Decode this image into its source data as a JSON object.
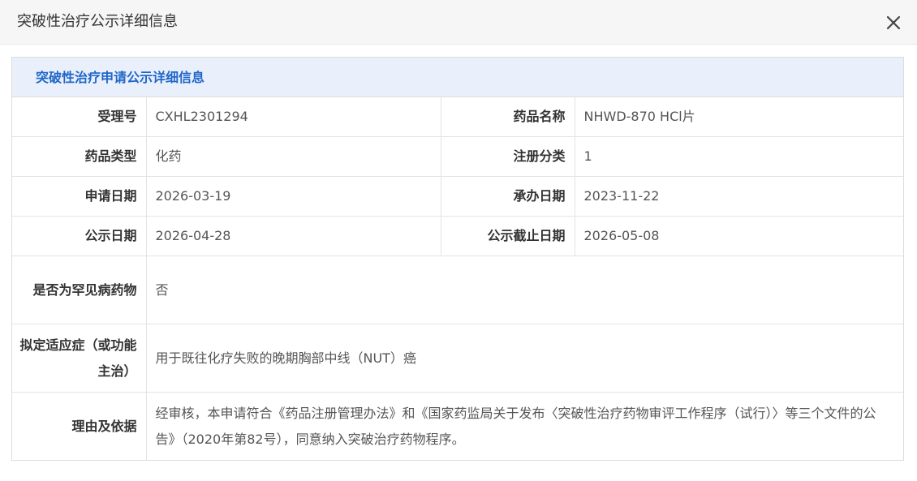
{
  "dialog": {
    "title": "突破性治疗公示详细信息",
    "close_icon": "close-icon"
  },
  "panel": {
    "heading": "突破性治疗申请公示详细信息",
    "rows": {
      "acceptance_no": {
        "label": "受理号",
        "value": "CXHL2301294"
      },
      "drug_name": {
        "label": "药品名称",
        "value": "NHWD-870 HCl片"
      },
      "drug_type": {
        "label": "药品类型",
        "value": "化药"
      },
      "reg_category": {
        "label": "注册分类",
        "value": "1"
      },
      "apply_date": {
        "label": "申请日期",
        "value": "2026-03-19"
      },
      "handle_date": {
        "label": "承办日期",
        "value": "2023-11-22"
      },
      "publish_date": {
        "label": "公示日期",
        "value": "2026-04-28"
      },
      "publish_end_date": {
        "label": "公示截止日期",
        "value": "2026-05-08"
      },
      "rare_disease": {
        "label": "是否为罕见病药物",
        "value": "否"
      },
      "indication": {
        "label": "拟定适应症（或功能主治）",
        "value": "用于既往化疗失败的晚期胸部中线（NUT）癌"
      },
      "reason": {
        "label": "理由及依据",
        "value": "经审核，本申请符合《药品注册管理办法》和《国家药监局关于发布〈突破性治疗药物审评工作程序（试行）〉等三个文件的公告》（2020年第82号），同意纳入突破治疗药物程序。"
      }
    }
  },
  "colors": {
    "header_bg": "#f6f6f6",
    "panel_head_bg": "#e9f0fb",
    "panel_head_text": "#1f66c9"
  }
}
